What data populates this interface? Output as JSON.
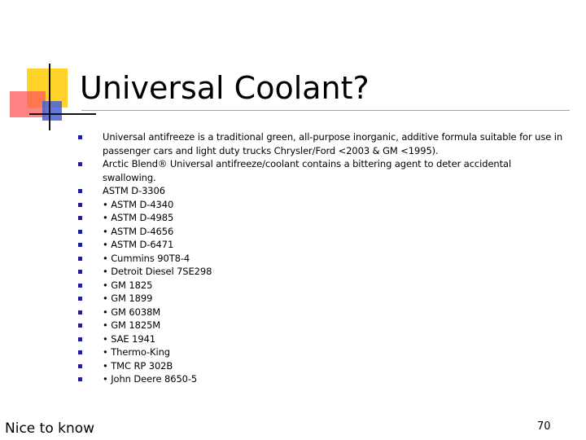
{
  "slide": {
    "title": "Universal Coolant?",
    "bullets": [
      "Universal antifreeze is a traditional green, all-purpose inorganic, additive formula suitable for use in passenger cars and light duty trucks Chrysler/Ford <2003 & GM <1995).",
      " Arctic Blend® Universal antifreeze/coolant contains a bittering agent to deter accidental swallowing.",
      "ASTM D-3306",
      "• ASTM D-4340",
      "• ASTM D-4985",
      "• ASTM D-4656",
      "• ASTM D-6471",
      "• Cummins 90T8-4",
      "• Detroit Diesel 7SE298",
      "• GM 1825",
      "• GM 1899",
      "• GM 6038M",
      "• GM 1825M",
      "• SAE 1941",
      "• Thermo-King",
      "• TMC RP 302B",
      "• John Deere 8650-5"
    ],
    "footer_note": "Nice to know",
    "page_number": "70"
  },
  "colors": {
    "bullet_marker": "#1f1f99",
    "deco_yellow": "#ffd42a",
    "deco_red": "#ff5a5a",
    "deco_blue": "#4a5fd6",
    "title_rule": "#9aa0c8",
    "text": "#000000"
  },
  "icons": {
    "bullet": "square-bullet-icon",
    "logo": "slide-logo-icon"
  }
}
